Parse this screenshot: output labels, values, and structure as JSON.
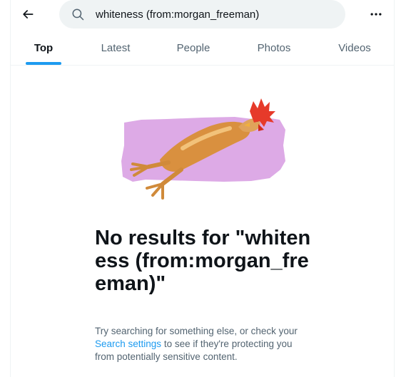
{
  "search": {
    "query": "whiteness (from:morgan_freeman)"
  },
  "tabs": [
    {
      "label": "Top",
      "active": true
    },
    {
      "label": "Latest",
      "active": false
    },
    {
      "label": "People",
      "active": false
    },
    {
      "label": "Photos",
      "active": false
    },
    {
      "label": "Videos",
      "active": false
    }
  ],
  "empty_state": {
    "title": "No results for \"whiteness (from:morgan_freeman)\"",
    "desc_before": "Try searching for something else, or check your ",
    "link_text": "Search settings",
    "desc_after": " to see if they're protecting you from potentially sensitive content."
  },
  "colors": {
    "accent": "#1d9bf0",
    "illustration_bg": "#ddaae6"
  },
  "icons": {
    "back": "arrow-left-icon",
    "search": "search-icon",
    "more": "more-horizontal-icon",
    "illustration": "rubber-chicken-illustration"
  }
}
